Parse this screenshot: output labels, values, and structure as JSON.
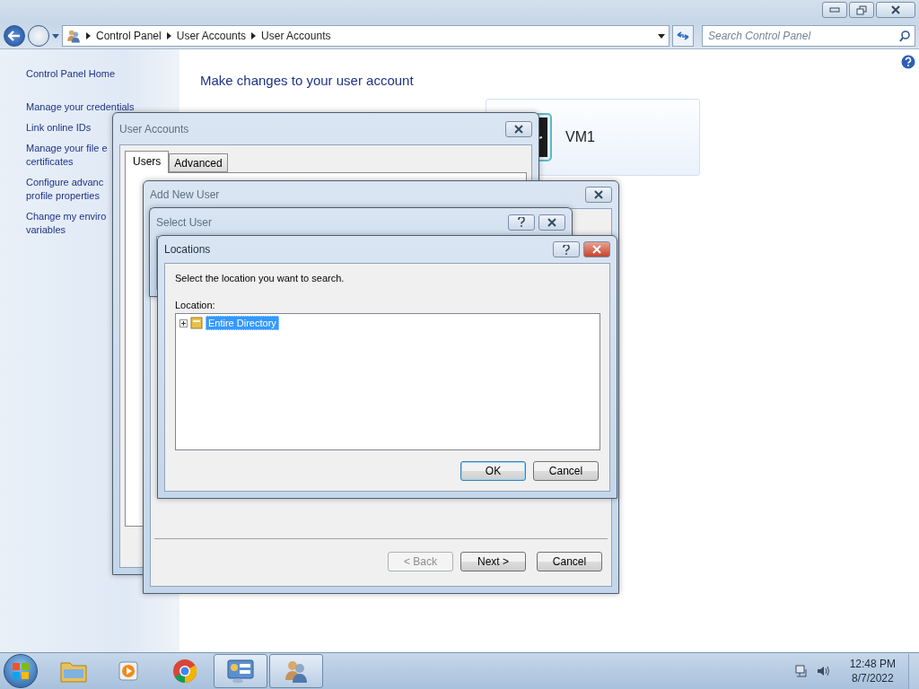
{
  "explorer": {
    "breadcrumbs": [
      "Control Panel",
      "User Accounts",
      "User Accounts"
    ],
    "search": {
      "placeholder": "Search Control Panel"
    },
    "sidebar": {
      "items": [
        {
          "lines": [
            "Control Panel Home"
          ]
        },
        {
          "lines": [
            "Manage your credentials"
          ]
        },
        {
          "lines": [
            "Link online IDs"
          ]
        },
        {
          "lines": [
            "Manage your file e",
            "certificates"
          ]
        },
        {
          "lines": [
            "Configure advanc",
            "profile properties"
          ]
        },
        {
          "lines": [
            "Change my enviro",
            "variables"
          ]
        }
      ]
    },
    "heading": "Make changes to your user account",
    "account": {
      "name": "VM1"
    }
  },
  "user_accounts_dialog": {
    "title": "User Accounts",
    "active": false,
    "tabs": [
      {
        "label": "Users",
        "selected": true
      },
      {
        "label": "Advanced",
        "selected": false
      }
    ]
  },
  "add_new_user_dialog": {
    "title": "Add New User",
    "active": false,
    "buttons": [
      {
        "label": "< Back",
        "disabled": true
      },
      {
        "label": "Next >",
        "disabled": false
      },
      {
        "label": "Cancel",
        "disabled": false
      }
    ]
  },
  "select_user_dialog": {
    "title": "Select User",
    "active": false
  },
  "locations_dialog": {
    "title": "Locations",
    "active": true,
    "prompt": "Select the location you want to search.",
    "location_label": "Location:",
    "tree": [
      {
        "label": "Entire Directory",
        "selected": true,
        "expanded": false
      }
    ],
    "buttons": [
      {
        "label": "OK",
        "default": true
      },
      {
        "label": "Cancel",
        "default": false
      }
    ]
  },
  "taskbar": {
    "items": [
      {
        "kind": "folder",
        "active": false
      },
      {
        "kind": "media",
        "active": false
      },
      {
        "kind": "browser",
        "active": false
      },
      {
        "kind": "control-panel",
        "active": true
      },
      {
        "kind": "users",
        "active": true
      }
    ],
    "time": "12:48 PM",
    "date": "8/7/2022"
  }
}
